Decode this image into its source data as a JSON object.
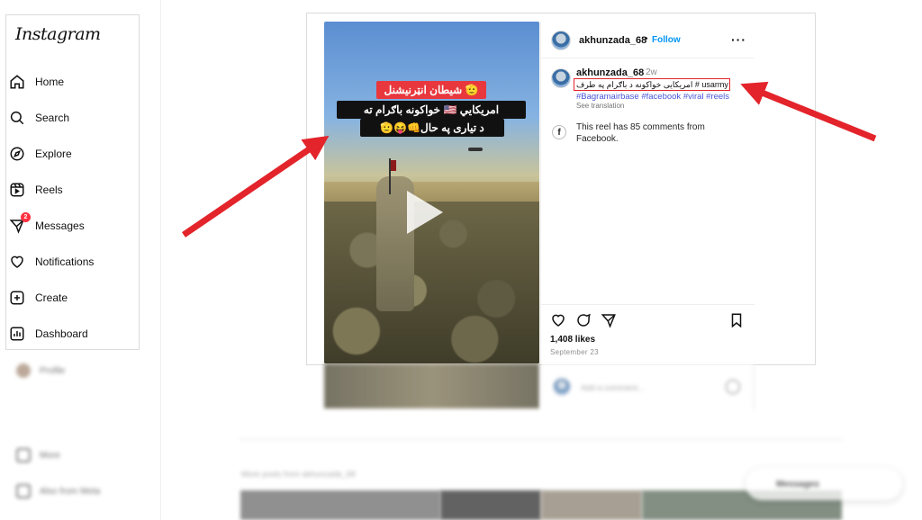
{
  "app": {
    "logo": "Instagram"
  },
  "sidebar": {
    "items": [
      {
        "label": "Home",
        "icon": "home-icon"
      },
      {
        "label": "Search",
        "icon": "search-icon"
      },
      {
        "label": "Explore",
        "icon": "compass-icon"
      },
      {
        "label": "Reels",
        "icon": "reels-icon"
      },
      {
        "label": "Messages",
        "icon": "messages-icon",
        "badge": "2"
      },
      {
        "label": "Notifications",
        "icon": "heart-icon"
      },
      {
        "label": "Create",
        "icon": "plus-square-icon"
      },
      {
        "label": "Dashboard",
        "icon": "dashboard-icon"
      }
    ],
    "profile_label": "Profile",
    "more_label": "More",
    "meta_label": "Also from Meta"
  },
  "post": {
    "username": "akhunzada_68",
    "follow_label": "Follow",
    "time_ago": "2w",
    "video_caption_red": "شیطان انټرنیشنل 🫡",
    "video_caption_line1": "امریکایي 🇺🇸 خواکونه باګرام ته",
    "video_caption_line2": "د تیاری په حال👊😝🫡",
    "caption_text": "امریکایی خواکونه د باګرام په طرف # usarmy",
    "hashtags": "#Bagramairbase #facebook #viral #reels",
    "see_translation": "See translation",
    "facebook_note": "This reel has 85 comments from Facebook.",
    "likes": "1,408 likes",
    "date": "September 23",
    "comment_placeholder": "Add a comment..."
  },
  "below": {
    "more_posts_label": "More posts from akhunzada_68",
    "messages_label": "Messages"
  },
  "colors": {
    "accent": "#0095f6",
    "hashtag": "#4a56d8",
    "annotation_red": "#e3242b",
    "badge": "#ff3040"
  }
}
